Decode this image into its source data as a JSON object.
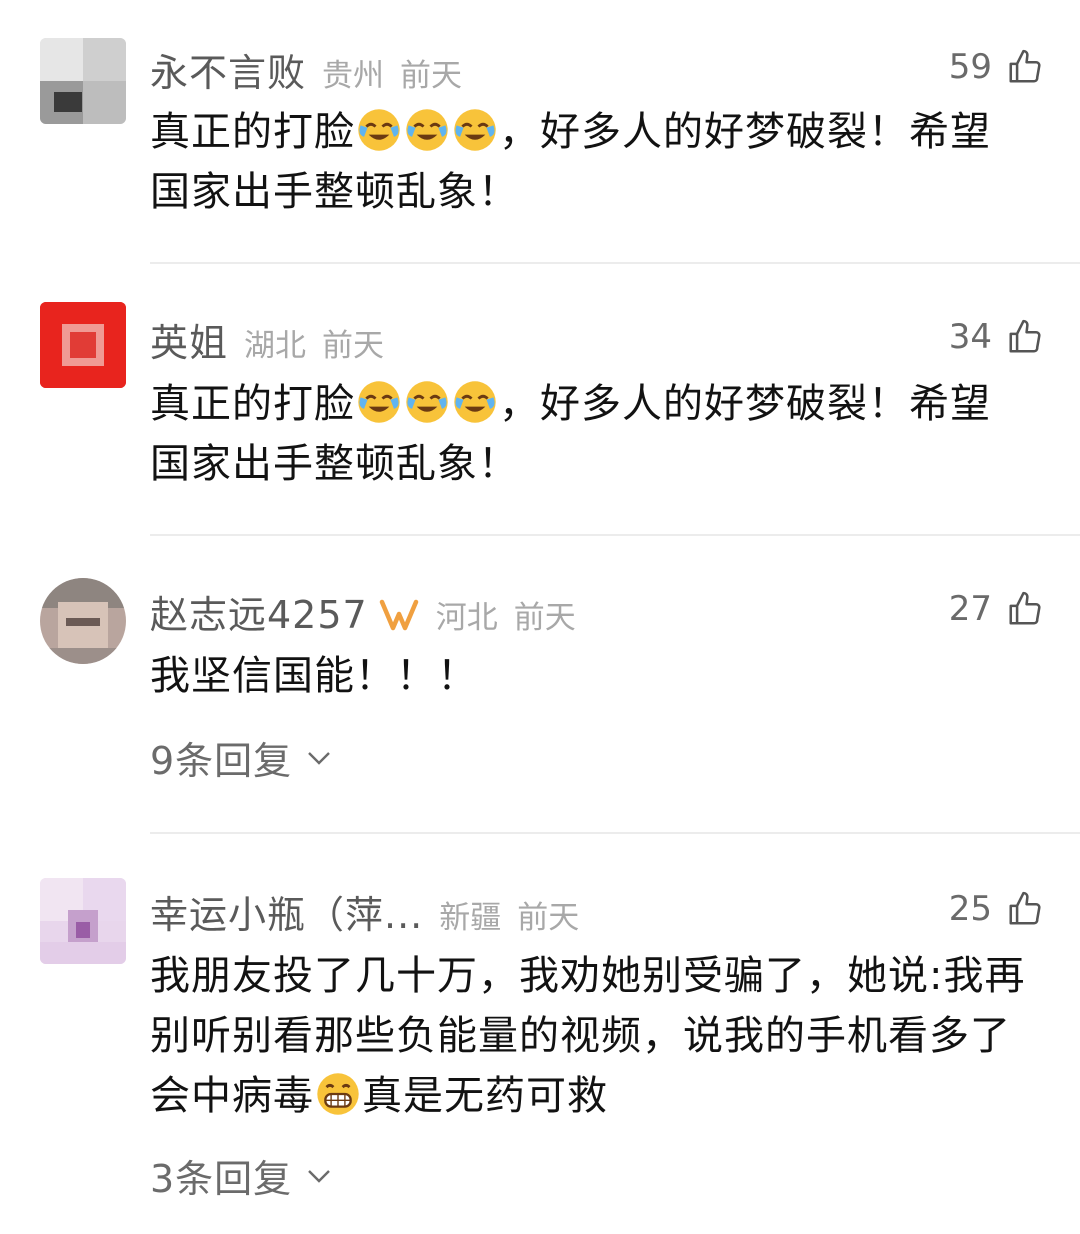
{
  "comments": [
    {
      "name": "永不言败",
      "location": "贵州",
      "time": "前天",
      "likes": "59",
      "text_line1": "真正的打脸",
      "text_line1_after": "，好多人的好梦破裂！希望",
      "text_line2": "国家出手整顿乱象！",
      "emoji": "crying-laughing-emoji"
    },
    {
      "name": "英姐",
      "location": "湖北",
      "time": "前天",
      "likes": "34",
      "text_line1": "真正的打脸",
      "text_line1_after": "，好多人的好梦破裂！希望",
      "text_line2": "国家出手整顿乱象！",
      "emoji": "crying-laughing-emoji"
    },
    {
      "name": "赵志远4257",
      "location": "河北",
      "time": "前天",
      "likes": "27",
      "text": "我坚信国能！！！",
      "replies": "9条回复",
      "badge": "membership-badge-icon"
    },
    {
      "name": "幸运小瓶（萍...",
      "location": "新疆",
      "time": "前天",
      "likes": "25",
      "text_line1": "我朋友投了几十万，我劝她别受骗了，她说:我再",
      "text_line2": "别听别看那些负能量的视频，说我的手机看多了",
      "text_line3a": "会中病毒",
      "text_line3b": "真是无药可救",
      "emoji": "grinning-emoji",
      "replies": "3条回复"
    }
  ],
  "colors": {
    "name": "#5a5a5a",
    "meta": "#a8a8a8",
    "text": "#121212",
    "divider": "#ececec",
    "badge": "#f0a040"
  }
}
